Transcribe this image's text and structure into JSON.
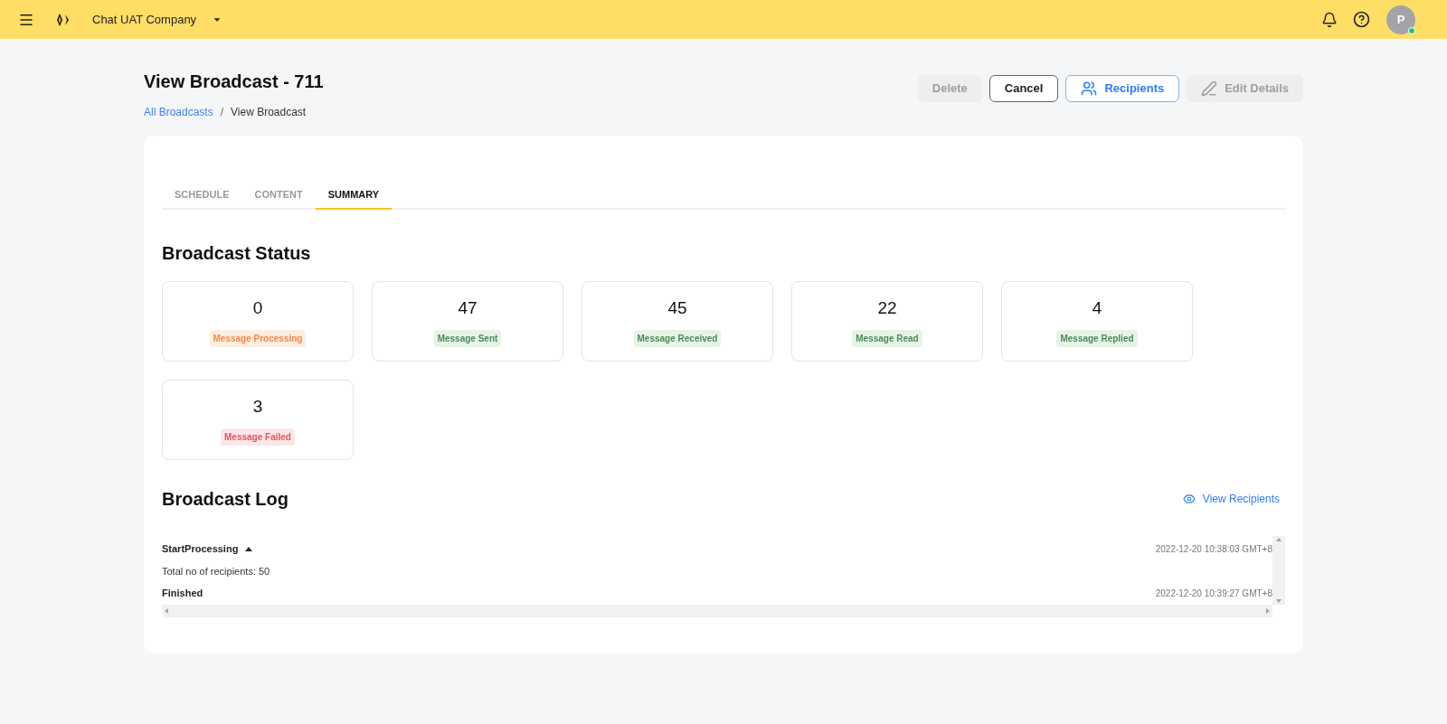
{
  "topbar": {
    "company": "Chat UAT Company",
    "avatar": "P",
    "online": true
  },
  "page": {
    "title": "View Broadcast - 711",
    "separator": "/",
    "breadcrumb": [
      {
        "label": "All Broadcasts",
        "kind": "link"
      },
      {
        "label": "View Broadcast",
        "kind": "current"
      }
    ]
  },
  "actions": [
    {
      "label": "Delete",
      "kind": "plain",
      "disabled": true
    },
    {
      "label": "Cancel",
      "kind": "outline",
      "disabled": false
    },
    {
      "label": "Recipients",
      "kind": "primary",
      "disabled": false
    },
    {
      "label": "Edit Details",
      "kind": "edit",
      "disabled": true
    }
  ],
  "tabs": [
    {
      "label": "SCHEDULE",
      "selected": false
    },
    {
      "label": "CONTENT",
      "selected": false
    },
    {
      "label": "SUMMARY",
      "selected": true
    }
  ],
  "status": {
    "title": "Broadcast Status",
    "stats": [
      {
        "value": "0",
        "label": "Message Processing",
        "kind": "pending"
      },
      {
        "value": "47",
        "label": "Message Sent",
        "kind": "success"
      },
      {
        "value": "45",
        "label": "Message Received",
        "kind": "success"
      },
      {
        "value": "22",
        "label": "Message Read",
        "kind": "success"
      },
      {
        "value": "4",
        "label": "Message Replied",
        "kind": "success"
      },
      {
        "value": "3",
        "label": "Message Failed",
        "kind": "failed"
      }
    ]
  },
  "log": {
    "title": "Broadcast Log",
    "link": "View Recipients",
    "entries": [
      {
        "event": "StartProcessing",
        "time": "2022-12-20 10:38:03 GMT+8",
        "kind": "group",
        "expanded": true,
        "detail": "Total no of recipients: 50"
      },
      {
        "event": "Finished",
        "time": "2022-12-20 10:39:27 GMT+8",
        "kind": "event"
      }
    ]
  }
}
